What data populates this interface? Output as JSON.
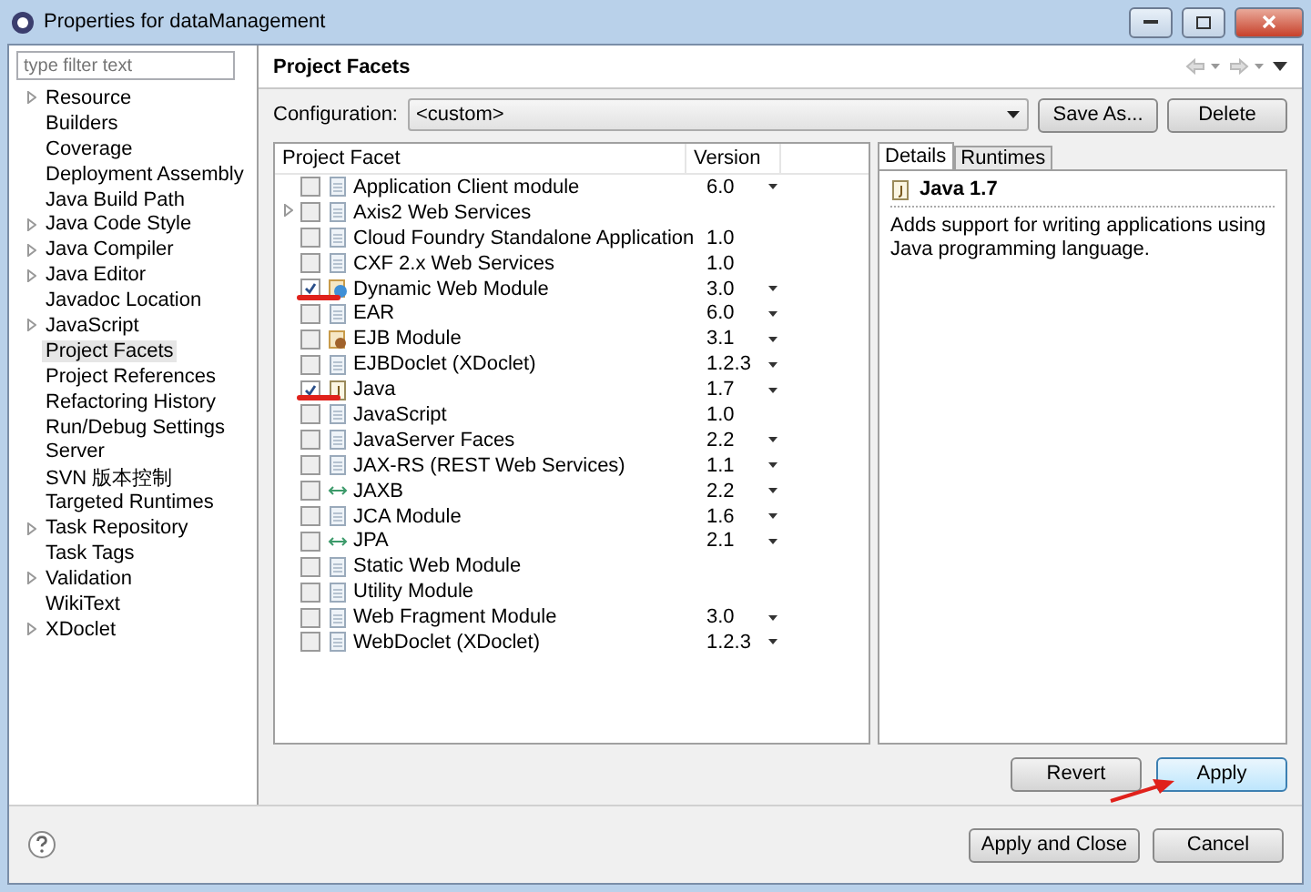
{
  "window": {
    "title": "Properties for dataManagement"
  },
  "filter": {
    "placeholder": "type filter text"
  },
  "sidebar": {
    "items": [
      {
        "label": "Resource",
        "expandable": true,
        "selected": false
      },
      {
        "label": "Builders",
        "expandable": false,
        "selected": false
      },
      {
        "label": "Coverage",
        "expandable": false,
        "selected": false
      },
      {
        "label": "Deployment Assembly",
        "expandable": false,
        "selected": false
      },
      {
        "label": "Java Build Path",
        "expandable": false,
        "selected": false
      },
      {
        "label": "Java Code Style",
        "expandable": true,
        "selected": false
      },
      {
        "label": "Java Compiler",
        "expandable": true,
        "selected": false
      },
      {
        "label": "Java Editor",
        "expandable": true,
        "selected": false
      },
      {
        "label": "Javadoc Location",
        "expandable": false,
        "selected": false
      },
      {
        "label": "JavaScript",
        "expandable": true,
        "selected": false
      },
      {
        "label": "Project Facets",
        "expandable": false,
        "selected": true
      },
      {
        "label": "Project References",
        "expandable": false,
        "selected": false
      },
      {
        "label": "Refactoring History",
        "expandable": false,
        "selected": false
      },
      {
        "label": "Run/Debug Settings",
        "expandable": false,
        "selected": false
      },
      {
        "label": "Server",
        "expandable": false,
        "selected": false
      },
      {
        "label": "SVN 版本控制",
        "expandable": false,
        "selected": false
      },
      {
        "label": "Targeted Runtimes",
        "expandable": false,
        "selected": false
      },
      {
        "label": "Task Repository",
        "expandable": true,
        "selected": false
      },
      {
        "label": "Task Tags",
        "expandable": false,
        "selected": false
      },
      {
        "label": "Validation",
        "expandable": true,
        "selected": false
      },
      {
        "label": "WikiText",
        "expandable": false,
        "selected": false
      },
      {
        "label": "XDoclet",
        "expandable": true,
        "selected": false
      }
    ]
  },
  "page": {
    "title": "Project Facets",
    "configuration_label": "Configuration:",
    "configuration_value": "<custom>",
    "buttons": [
      "Save As...",
      "Delete"
    ]
  },
  "table": {
    "columns": [
      "Project Facet",
      "Version"
    ],
    "rows": [
      {
        "name": "Application Client module",
        "version": "6.0",
        "dropdown": true,
        "checked": false,
        "expandable": false,
        "kind": "page",
        "marked": false
      },
      {
        "name": "Axis2 Web Services",
        "dropdown": false,
        "checked": false,
        "expandable": true,
        "kind": "page",
        "marked": false
      },
      {
        "name": "Cloud Foundry Standalone Application",
        "version": "1.0",
        "dropdown": false,
        "checked": false,
        "expandable": false,
        "kind": "page",
        "marked": false
      },
      {
        "name": "CXF 2.x Web Services",
        "version": "1.0",
        "dropdown": false,
        "checked": false,
        "expandable": false,
        "kind": "page",
        "marked": false
      },
      {
        "name": "Dynamic Web Module",
        "version": "3.0",
        "dropdown": true,
        "checked": true,
        "expandable": false,
        "kind": "globe",
        "marked": true
      },
      {
        "name": "EAR",
        "version": "6.0",
        "dropdown": true,
        "checked": false,
        "expandable": false,
        "kind": "page",
        "marked": false
      },
      {
        "name": "EJB Module",
        "version": "3.1",
        "dropdown": true,
        "checked": false,
        "expandable": false,
        "kind": "bean",
        "marked": false
      },
      {
        "name": "EJBDoclet (XDoclet)",
        "version": "1.2.3",
        "dropdown": true,
        "checked": false,
        "expandable": false,
        "kind": "page",
        "marked": false
      },
      {
        "name": "Java",
        "version": "1.7",
        "dropdown": true,
        "checked": true,
        "expandable": false,
        "kind": "java",
        "marked": true
      },
      {
        "name": "JavaScript",
        "version": "1.0",
        "dropdown": false,
        "checked": false,
        "expandable": false,
        "kind": "page",
        "marked": false
      },
      {
        "name": "JavaServer Faces",
        "version": "2.2",
        "dropdown": true,
        "checked": false,
        "expandable": false,
        "kind": "page",
        "marked": false
      },
      {
        "name": "JAX-RS (REST Web Services)",
        "version": "1.1",
        "dropdown": true,
        "checked": false,
        "expandable": false,
        "kind": "page",
        "marked": false
      },
      {
        "name": "JAXB",
        "version": "2.2",
        "dropdown": true,
        "checked": false,
        "expandable": false,
        "kind": "link",
        "marked": false
      },
      {
        "name": "JCA Module",
        "version": "1.6",
        "dropdown": true,
        "checked": false,
        "expandable": false,
        "kind": "page",
        "marked": false
      },
      {
        "name": "JPA",
        "version": "2.1",
        "dropdown": true,
        "checked": false,
        "expandable": false,
        "kind": "link",
        "marked": false
      },
      {
        "name": "Static Web Module",
        "dropdown": false,
        "checked": false,
        "expandable": false,
        "kind": "page",
        "marked": false
      },
      {
        "name": "Utility Module",
        "dropdown": false,
        "checked": false,
        "expandable": false,
        "kind": "page",
        "marked": false
      },
      {
        "name": "Web Fragment Module",
        "version": "3.0",
        "dropdown": true,
        "checked": false,
        "expandable": false,
        "kind": "page",
        "marked": false
      },
      {
        "name": "WebDoclet (XDoclet)",
        "version": "1.2.3",
        "dropdown": true,
        "checked": false,
        "expandable": false,
        "kind": "page",
        "marked": false
      }
    ]
  },
  "details": {
    "tabs": [
      {
        "label": "Details",
        "selected": true
      },
      {
        "label": "Runtimes",
        "selected": false
      }
    ],
    "heading": "Java 1.7",
    "description": "Adds support for writing applications using Java programming language."
  },
  "page_buttons": [
    {
      "label": "Revert",
      "focused": false,
      "pointed": false
    },
    {
      "label": "Apply",
      "focused": true,
      "pointed": true
    }
  ],
  "dialog_buttons": [
    "Apply and Close",
    "Cancel"
  ]
}
